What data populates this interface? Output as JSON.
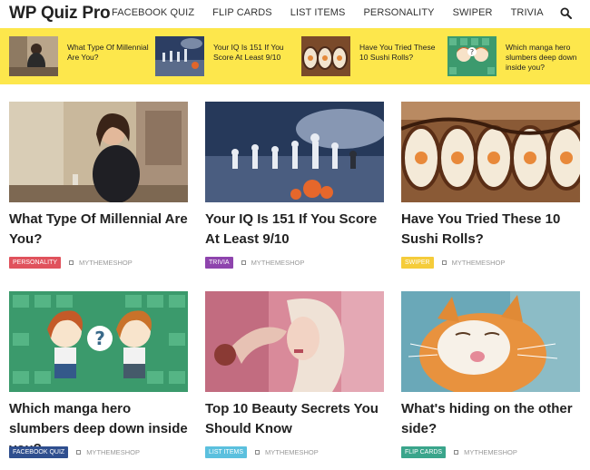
{
  "header": {
    "logo": "WP Quiz Pro",
    "nav": [
      "FACEBOOK QUIZ",
      "FLIP CARDS",
      "LIST ITEMS",
      "PERSONALITY",
      "SWIPER",
      "TRIVIA"
    ],
    "search_icon": "search-icon"
  },
  "strip": {
    "background": "#fde74c",
    "items": [
      {
        "title": "What Type Of Millennial Are You?"
      },
      {
        "title": "Your IQ Is 151 If You Score At Least 9/10"
      },
      {
        "title": "Have You Tried These 10 Sushi Rolls?"
      },
      {
        "title": "Which manga hero slumbers deep down inside you?"
      }
    ]
  },
  "cards": [
    {
      "title": "What Type Of Millennial Are You?",
      "category": "PERSONALITY",
      "category_color": "#e0525c",
      "author": "MYTHEMESHOP"
    },
    {
      "title": "Your IQ Is 151 If You Score At Least 9/10",
      "category": "TRIVIA",
      "category_color": "#8e44ad",
      "author": "MYTHEMESHOP"
    },
    {
      "title": "Have You Tried These 10 Sushi Rolls?",
      "category": "SWIPER",
      "category_color": "#f5cc3a",
      "author": "MYTHEMESHOP"
    },
    {
      "title": "Which manga hero slumbers deep down inside you?",
      "category": "FACEBOOK QUIZ",
      "category_color": "#2f4f8f",
      "author": "MYTHEMESHOP"
    },
    {
      "title": "Top 10 Beauty Secrets You Should Know",
      "category": "LIST ITEMS",
      "category_color": "#5bc0de",
      "author": "MYTHEMESHOP"
    },
    {
      "title": "What's hiding on the other side?",
      "category": "FLIP CARDS",
      "category_color": "#3aa58b",
      "author": "MYTHEMESHOP"
    }
  ]
}
